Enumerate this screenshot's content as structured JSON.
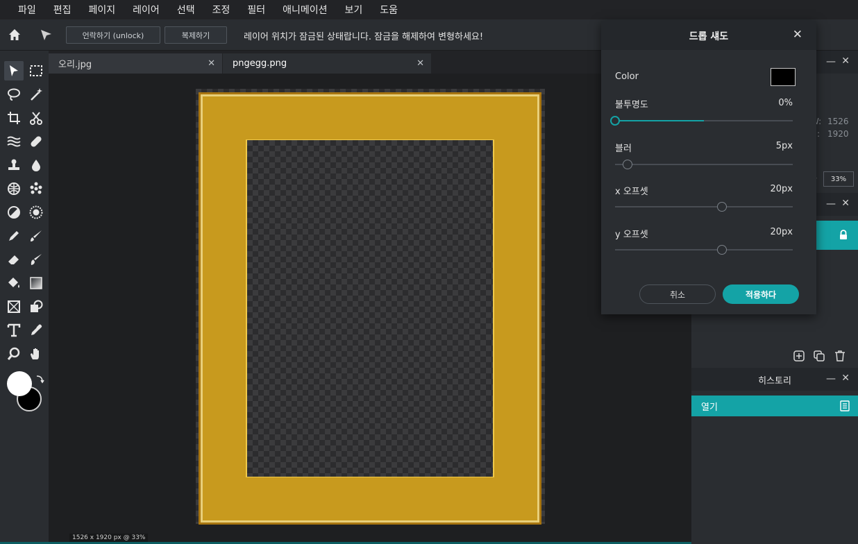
{
  "menu": [
    "파일",
    "편집",
    "페이지",
    "레이어",
    "선택",
    "조정",
    "필터",
    "애니메이션",
    "보기",
    "도움"
  ],
  "toolbar": {
    "home_icon": "home-icon",
    "pointer_icon": "pointer-icon",
    "unlock_label": "언락하기 (unlock)",
    "duplicate_label": "복제하기",
    "lock_message": "레이어 위치가 잠금된 상태랍니다. 잠금을 해제하여 변형하세요!"
  },
  "tabs": [
    {
      "label": "오리.jpg",
      "active": false
    },
    {
      "label": "pngegg.png",
      "active": true
    }
  ],
  "tools": [
    "move-tool-icon",
    "marquee-select-icon",
    "lasso-icon",
    "magic-wand-icon",
    "crop-icon",
    "scissors-icon",
    "liquify-icon",
    "bandage-icon",
    "stamp-icon",
    "blur-drop-icon",
    "sponge-icon",
    "dots-icon",
    "dodge-icon",
    "sharpen-icon",
    "pencil-icon",
    "brush-icon",
    "eraser-icon",
    "smudge-brush-icon",
    "paint-bucket-icon",
    "gradient-icon",
    "frame-icon",
    "shape-icon",
    "text-icon",
    "eyedropper-icon",
    "zoom-icon",
    "hand-icon"
  ],
  "colors": {
    "foreground": "#ffffff",
    "background": "#000000",
    "accent": "#14a3a6"
  },
  "status": {
    "text": "1526 x 1920 px @ 33%"
  },
  "right_panel": {
    "info_w_label": "W:",
    "info_w_value": "1526",
    "info_h_label": "H:",
    "info_h_value": "1920",
    "zoom_value": "33%",
    "history_title": "히스토리",
    "history_items": [
      "열기"
    ]
  },
  "dialog": {
    "title": "드롭 섀도",
    "color_label": "Color",
    "color_value": "#000000",
    "opacity_label": "불투명도",
    "opacity_value": "0%",
    "opacity_fraction": 0.0,
    "blur_label": "블러",
    "blur_value": "5px",
    "blur_fraction": 0.07,
    "x_offset_label": "x 오프셋",
    "x_offset_value": "20px",
    "x_offset_fraction": 0.6,
    "y_offset_label": "y 오프셋",
    "y_offset_value": "20px",
    "y_offset_fraction": 0.6,
    "cancel_label": "취소",
    "apply_label": "적용하다"
  }
}
